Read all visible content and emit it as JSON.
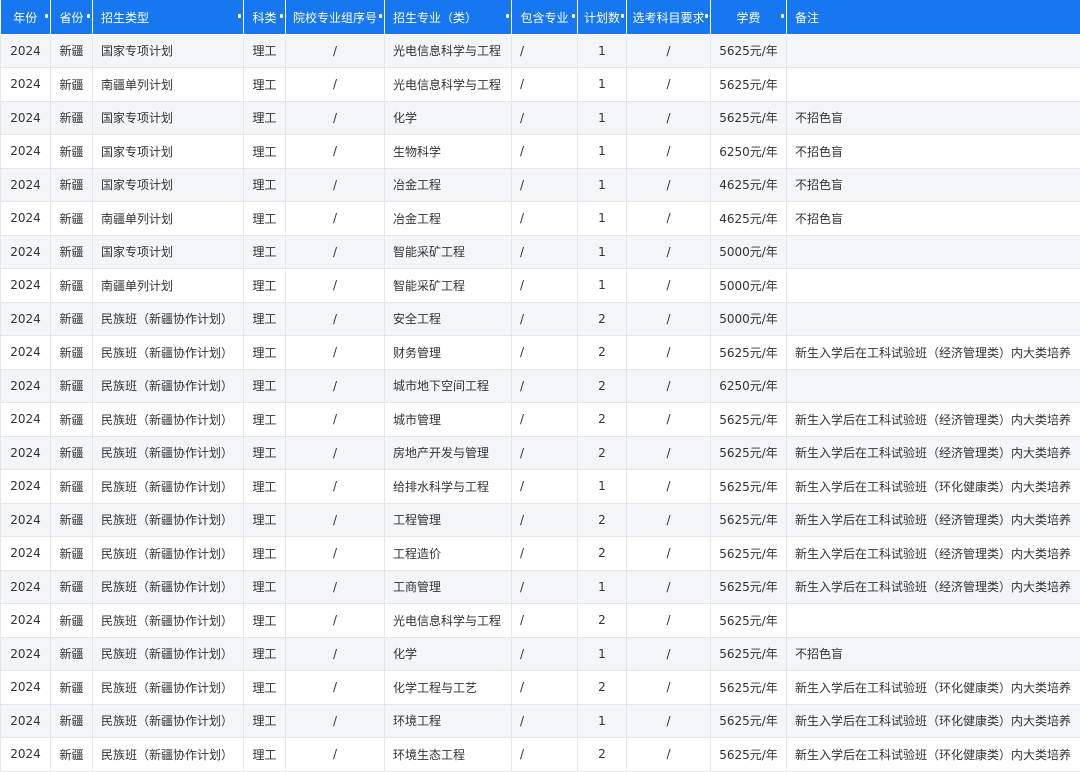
{
  "headers": [
    "年份",
    "省份",
    "招生类型",
    "科类",
    "院校专业组序号",
    "招生专业（类）",
    "包含专业",
    "计划数",
    "选考科目要求",
    "学费",
    "备注"
  ],
  "rows": [
    [
      "2024",
      "新疆",
      "国家专项计划",
      "理工",
      "/",
      "光电信息科学与工程",
      "/",
      "1",
      "/",
      "5625元/年",
      ""
    ],
    [
      "2024",
      "新疆",
      "南疆单列计划",
      "理工",
      "/",
      "光电信息科学与工程",
      "/",
      "1",
      "/",
      "5625元/年",
      ""
    ],
    [
      "2024",
      "新疆",
      "国家专项计划",
      "理工",
      "/",
      "化学",
      "/",
      "1",
      "/",
      "5625元/年",
      "不招色盲"
    ],
    [
      "2024",
      "新疆",
      "国家专项计划",
      "理工",
      "/",
      "生物科学",
      "/",
      "1",
      "/",
      "6250元/年",
      "不招色盲"
    ],
    [
      "2024",
      "新疆",
      "国家专项计划",
      "理工",
      "/",
      "冶金工程",
      "/",
      "1",
      "/",
      "4625元/年",
      "不招色盲"
    ],
    [
      "2024",
      "新疆",
      "南疆单列计划",
      "理工",
      "/",
      "冶金工程",
      "/",
      "1",
      "/",
      "4625元/年",
      "不招色盲"
    ],
    [
      "2024",
      "新疆",
      "国家专项计划",
      "理工",
      "/",
      "智能采矿工程",
      "/",
      "1",
      "/",
      "5000元/年",
      ""
    ],
    [
      "2024",
      "新疆",
      "南疆单列计划",
      "理工",
      "/",
      "智能采矿工程",
      "/",
      "1",
      "/",
      "5000元/年",
      ""
    ],
    [
      "2024",
      "新疆",
      "民族班（新疆协作计划）",
      "理工",
      "/",
      "安全工程",
      "/",
      "2",
      "/",
      "5000元/年",
      ""
    ],
    [
      "2024",
      "新疆",
      "民族班（新疆协作计划）",
      "理工",
      "/",
      "财务管理",
      "/",
      "2",
      "/",
      "5625元/年",
      "新生入学后在工科试验班（经济管理类）内大类培养"
    ],
    [
      "2024",
      "新疆",
      "民族班（新疆协作计划）",
      "理工",
      "/",
      "城市地下空间工程",
      "/",
      "2",
      "/",
      "6250元/年",
      ""
    ],
    [
      "2024",
      "新疆",
      "民族班（新疆协作计划）",
      "理工",
      "/",
      "城市管理",
      "/",
      "2",
      "/",
      "5625元/年",
      "新生入学后在工科试验班（经济管理类）内大类培养"
    ],
    [
      "2024",
      "新疆",
      "民族班（新疆协作计划）",
      "理工",
      "/",
      "房地产开发与管理",
      "/",
      "2",
      "/",
      "5625元/年",
      "新生入学后在工科试验班（经济管理类）内大类培养"
    ],
    [
      "2024",
      "新疆",
      "民族班（新疆协作计划）",
      "理工",
      "/",
      "给排水科学与工程",
      "/",
      "1",
      "/",
      "5625元/年",
      "新生入学后在工科试验班（环化健康类）内大类培养"
    ],
    [
      "2024",
      "新疆",
      "民族班（新疆协作计划）",
      "理工",
      "/",
      "工程管理",
      "/",
      "2",
      "/",
      "5625元/年",
      "新生入学后在工科试验班（经济管理类）内大类培养"
    ],
    [
      "2024",
      "新疆",
      "民族班（新疆协作计划）",
      "理工",
      "/",
      "工程造价",
      "/",
      "2",
      "/",
      "5625元/年",
      "新生入学后在工科试验班（经济管理类）内大类培养"
    ],
    [
      "2024",
      "新疆",
      "民族班（新疆协作计划）",
      "理工",
      "/",
      "工商管理",
      "/",
      "1",
      "/",
      "5625元/年",
      "新生入学后在工科试验班（经济管理类）内大类培养"
    ],
    [
      "2024",
      "新疆",
      "民族班（新疆协作计划）",
      "理工",
      "/",
      "光电信息科学与工程",
      "/",
      "2",
      "/",
      "5625元/年",
      ""
    ],
    [
      "2024",
      "新疆",
      "民族班（新疆协作计划）",
      "理工",
      "/",
      "化学",
      "/",
      "1",
      "/",
      "5625元/年",
      "不招色盲"
    ],
    [
      "2024",
      "新疆",
      "民族班（新疆协作计划）",
      "理工",
      "/",
      "化学工程与工艺",
      "/",
      "2",
      "/",
      "5625元/年",
      "新生入学后在工科试验班（环化健康类）内大类培养"
    ],
    [
      "2024",
      "新疆",
      "民族班（新疆协作计划）",
      "理工",
      "/",
      "环境工程",
      "/",
      "1",
      "/",
      "5625元/年",
      "新生入学后在工科试验班（环化健康类）内大类培养"
    ],
    [
      "2024",
      "新疆",
      "民族班（新疆协作计划）",
      "理工",
      "/",
      "环境生态工程",
      "/",
      "2",
      "/",
      "5625元/年",
      "新生入学后在工科试验班（环化健康类）内大类培养"
    ]
  ]
}
